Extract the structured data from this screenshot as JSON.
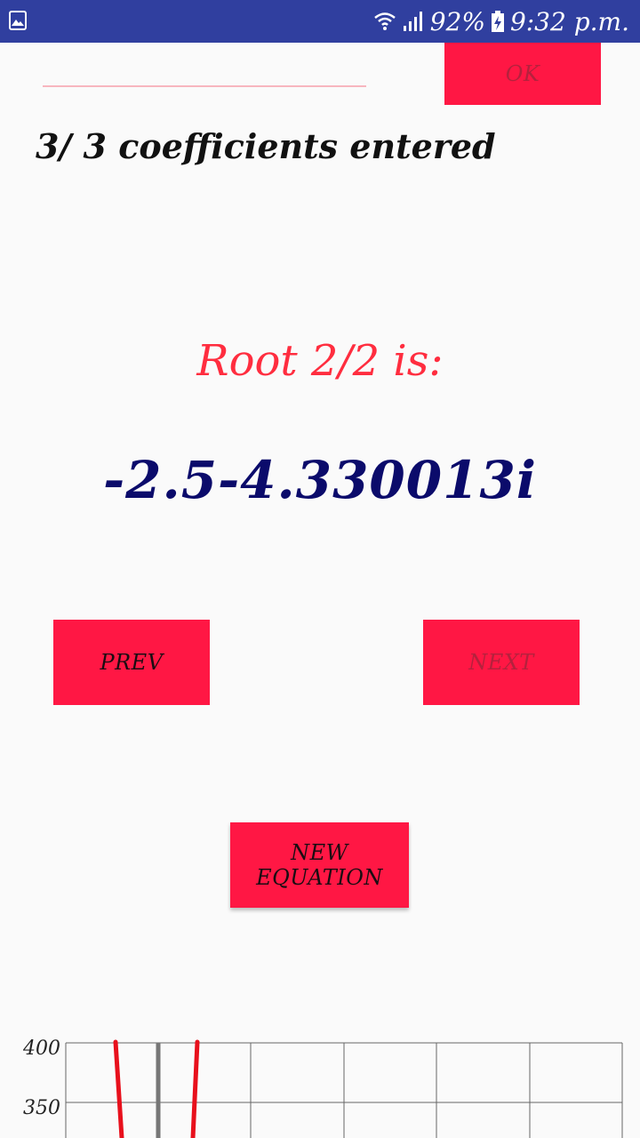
{
  "status_bar": {
    "battery": "92%",
    "time": "9:32 p.m.",
    "icons": [
      "image-icon",
      "wifi-icon",
      "signal-icon",
      "battery-charging-icon"
    ],
    "background": "#303f9f"
  },
  "input": {
    "ok_label": "OK"
  },
  "coefficients_text": "3/ 3 coefficients entered",
  "root": {
    "title": "Root 2/2 is:",
    "value": "-2.5-4.330013i",
    "title_color": "#ff2d3f",
    "value_color": "#0b0b6b"
  },
  "nav": {
    "prev_label": "PREV",
    "next_label": "NEXT"
  },
  "new_equation_label": "NEW EQUATION",
  "accent": "#ff1744",
  "chart_data": {
    "type": "line",
    "ylabel_ticks": [
      "400",
      "350"
    ],
    "grid": true,
    "series": [
      {
        "values": [
          [
            -2.2,
            400
          ],
          [
            -2.05,
            330
          ]
        ]
      },
      {
        "values": [
          [
            2.2,
            400
          ],
          [
            2.05,
            330
          ]
        ]
      }
    ],
    "axis_color": "#777777",
    "curve_color": "#e8101c"
  }
}
